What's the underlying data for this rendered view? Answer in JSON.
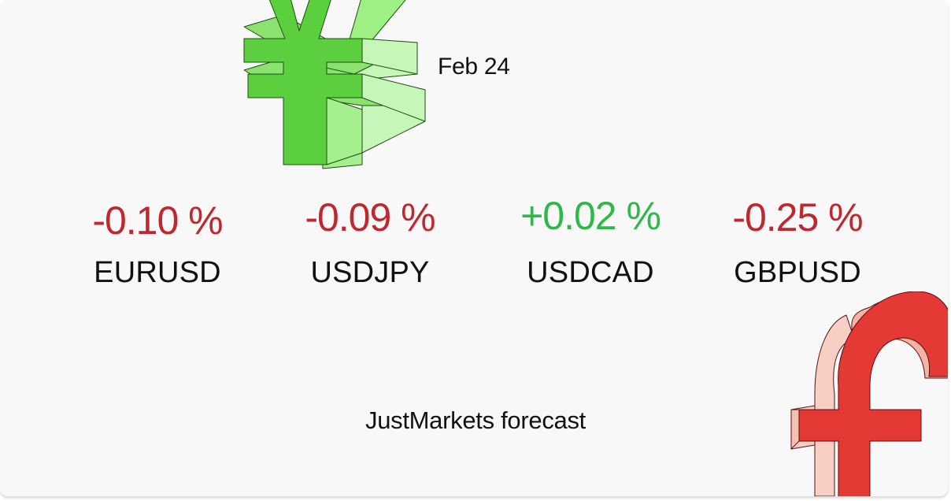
{
  "header": {
    "date": "Feb 24"
  },
  "pairs": [
    {
      "change": "-0.10 %",
      "symbol": "EURUSD",
      "direction": "down"
    },
    {
      "change": "-0.09 %",
      "symbol": "USDJPY",
      "direction": "down"
    },
    {
      "change": "+0.02 %",
      "symbol": "USDCAD",
      "direction": "up"
    },
    {
      "change": "-0.25 %",
      "symbol": "GBPUSD",
      "direction": "down"
    }
  ],
  "footer": {
    "label": "JustMarkets forecast"
  },
  "colors": {
    "negative": "#c0282f",
    "positive": "#2fb84a",
    "yen_green": "#5ccf3f",
    "pound_red": "#e53935",
    "background": "#f8f8f8"
  },
  "decorations": [
    "yen-symbol-icon",
    "pound-symbol-icon"
  ]
}
